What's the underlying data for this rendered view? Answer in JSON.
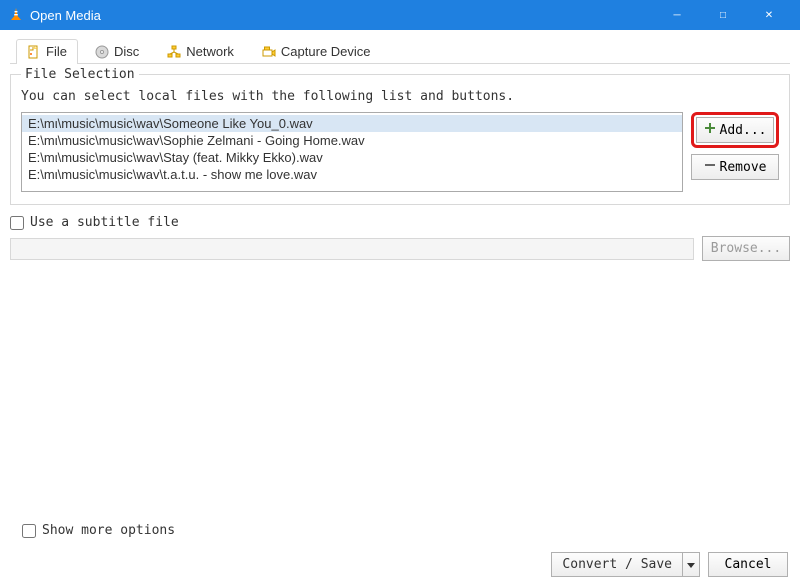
{
  "window": {
    "title": "Open Media"
  },
  "tabs": {
    "file": {
      "label": "File",
      "active": true
    },
    "disc": {
      "label": "Disc"
    },
    "network": {
      "label": "Network"
    },
    "capture": {
      "label": "Capture Device"
    }
  },
  "file_selection": {
    "group_title": "File Selection",
    "help": "You can select local files with the following list and buttons.",
    "files": [
      "E:\\mι\\music\\music\\wav\\Someone Like You_0.wav",
      "E:\\mι\\music\\music\\wav\\Sophie Zelmani - Going Home.wav",
      "E:\\mι\\music\\music\\wav\\Stay (feat. Mikky Ekko).wav",
      "E:\\mι\\music\\music\\wav\\t.a.t.u. - show me love.wav"
    ],
    "selected_index": 0,
    "add_label": "Add...",
    "remove_label": "Remove"
  },
  "subtitle": {
    "checkbox_label": "Use a subtitle file",
    "browse_label": "Browse..."
  },
  "show_more": {
    "label": "Show more options"
  },
  "footer": {
    "convert_label": "Convert / Save",
    "cancel_label": "Cancel"
  }
}
